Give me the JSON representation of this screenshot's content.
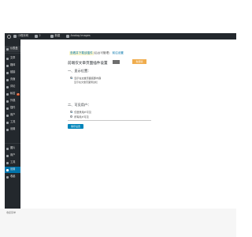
{
  "adminbar": {
    "site_name": "小程序网",
    "comments_count": "2",
    "new_label": "新建",
    "plugin_label": "Analog Images"
  },
  "sidebar": {
    "items": [
      {
        "label": "仪表盘",
        "icon": "dashboard-icon"
      },
      {
        "label": "文章",
        "icon": "pin-icon"
      },
      {
        "label": "媒体",
        "icon": "media-icon"
      },
      {
        "label": "链接",
        "icon": "link-icon"
      },
      {
        "label": "页面",
        "icon": "page-icon"
      },
      {
        "label": "评论",
        "icon": "comment-icon"
      },
      {
        "label": "私信",
        "icon": "message-icon"
      },
      {
        "label": "外观",
        "icon": "brush-icon"
      },
      {
        "label": "插件",
        "icon": "plugin-icon"
      },
      {
        "label": "用户",
        "icon": "users-icon"
      },
      {
        "label": "工具",
        "icon": "tool-icon"
      },
      {
        "label": "设置",
        "icon": "settings-icon"
      }
    ],
    "lower_items": [
      {
        "label": "图片",
        "icon": "image-icon"
      },
      {
        "label": "用户",
        "icon": "user-icon"
      },
      {
        "label": "工具",
        "icon": "tool-icon"
      },
      {
        "label": "设置",
        "icon": "settings-icon"
      },
      {
        "label": "收起",
        "icon": "collapse-icon"
      }
    ],
    "badge": "2",
    "current_index": 3
  },
  "notice": {
    "highlight": "查看并下载该插件",
    "text": "(后台可管理)",
    "link": "前往设置"
  },
  "page": {
    "title": "前端仅文章页面插件设置",
    "version_tag": "免费版"
  },
  "section1": {
    "heading": "一、显示位置：",
    "options": [
      {
        "label": "显示在文章页面底部内容",
        "checked": true
      },
      {
        "label": "显示在文章页面侧边栏",
        "checked": false
      }
    ]
  },
  "section2": {
    "heading": "二、可见用户：",
    "options": [
      {
        "label": "仅登录用户可见",
        "checked": true
      },
      {
        "label": "所有用户可见",
        "checked": false
      }
    ]
  },
  "save_button": "保存设置",
  "bottom_label": "收起菜单",
  "colors": {
    "adminbar": "#23282d",
    "accent": "#0073aa",
    "button": "#0085ba",
    "badge": "#d54e21",
    "tag": "#f0ad4e"
  }
}
